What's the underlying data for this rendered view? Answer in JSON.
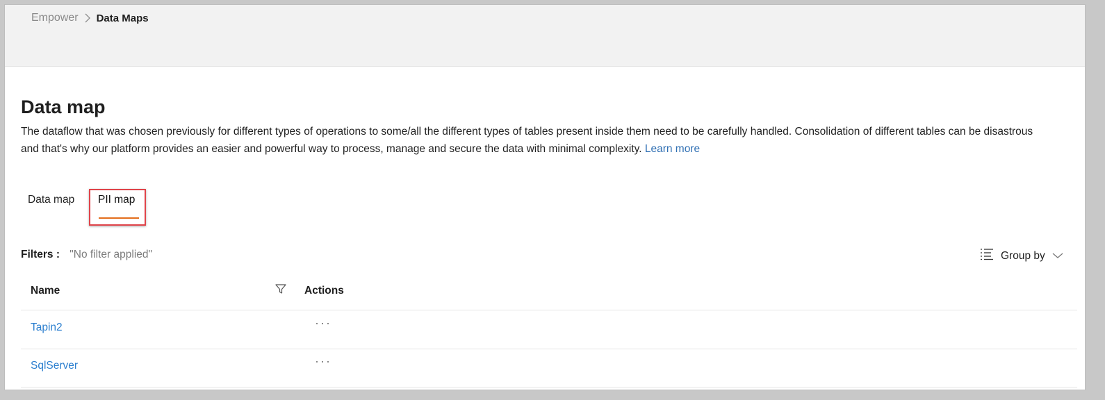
{
  "breadcrumb": {
    "root": "Empower",
    "current": "Data Maps"
  },
  "page": {
    "title": "Data map",
    "description": "The dataflow that was chosen previously for different types of operations to some/all the different types of tables present inside them need to be carefully handled. Consolidation of different tables can be disastrous and that's why our platform provides an easier and powerful way to process, manage and secure the data with minimal complexity.",
    "learn_more": "Learn more"
  },
  "tabs": [
    {
      "label": "Data map",
      "active": false
    },
    {
      "label": "PII map",
      "active": true
    }
  ],
  "filters": {
    "label": "Filters :",
    "value": "\"No filter applied\""
  },
  "group_by": {
    "label": "Group by",
    "icon": "list-icon"
  },
  "table": {
    "columns": [
      "Name",
      "Actions"
    ],
    "rows": [
      {
        "name": "Tapin2",
        "actions": "···"
      },
      {
        "name": "SqlServer",
        "actions": "···"
      }
    ]
  },
  "colors": {
    "accent_tab_underline": "#e36d1b",
    "highlight_box": "#e0444a",
    "link": "#2c7fcf"
  }
}
